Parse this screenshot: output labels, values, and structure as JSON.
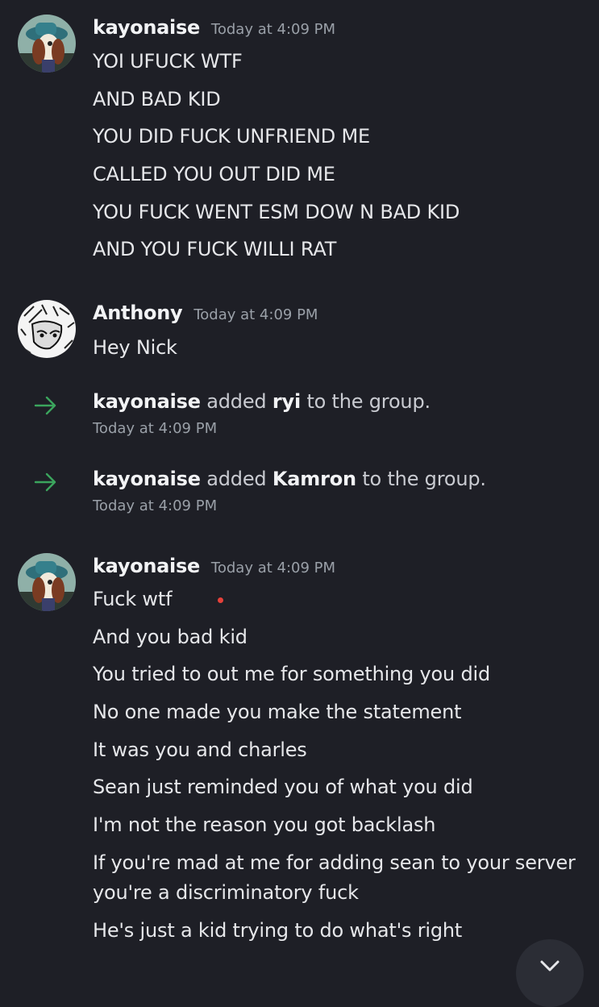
{
  "messages": [
    {
      "author": "kayonaise",
      "time": "Today at 4:09 PM",
      "lines": [
        "YOI UFUCK WTF",
        "AND BAD KID",
        "YOU DID FUCK UNFRIEND ME",
        "CALLED YOU OUT DID ME",
        "YOU FUCK WENT ESM DOW N BAD KID",
        "AND YOU FUCK WILLI RAT"
      ]
    },
    {
      "author": "Anthony",
      "time": "Today at 4:09 PM",
      "lines": [
        "Hey Nick"
      ]
    },
    {
      "author": "kayonaise",
      "time": "Today at 4:09 PM",
      "lines": [
        "Fuck wtf",
        "And you bad kid",
        "You tried to out me for something you did",
        "No one made you make the statement",
        "It was you and charles",
        "Sean just reminded you of what you did",
        "I'm not the reason you got backlash",
        "If you're mad at me for adding sean to your server you're a discriminatory fuck",
        "He's just a kid trying to do what's right"
      ]
    }
  ],
  "system_events": [
    {
      "actor": "kayonaise",
      "verb": "added",
      "target": "ryi",
      "suffix": "to the group.",
      "time": "Today at 4:09 PM",
      "icon": "arrow-right-icon"
    },
    {
      "actor": "kayonaise",
      "verb": "added",
      "target": "Kamron",
      "suffix": "to the group.",
      "time": "Today at 4:09 PM",
      "icon": "arrow-right-icon"
    }
  ],
  "colors": {
    "background": "#1e1f26",
    "text": "#e6e7ea",
    "timestamp": "#9aa0a8",
    "join_arrow": "#3ba55d",
    "unread_dot": "#e6413a"
  },
  "jump_button_icon": "chevron-down-icon"
}
